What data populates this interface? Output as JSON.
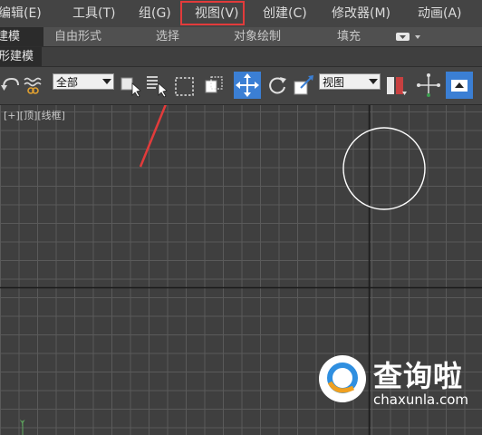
{
  "menu": [
    {
      "label": "编辑(E)"
    },
    {
      "label": "工具(T)"
    },
    {
      "label": "组(G)"
    },
    {
      "label": "视图(V)"
    },
    {
      "label": "创建(C)"
    },
    {
      "label": "修改器(M)"
    },
    {
      "label": "动画(A)"
    }
  ],
  "ribbon": {
    "active_tab": "建模",
    "tabs": [
      "自由形式",
      "选择",
      "对象绘制",
      "填充"
    ]
  },
  "subbar": {
    "active_tab": "形建模"
  },
  "toolbar": {
    "filter_select": "全部",
    "coord_select": "视图"
  },
  "viewport": {
    "label": "[+][顶][线框]"
  },
  "watermark": {
    "brand": "查询啦",
    "domain": "chaxunla.com"
  },
  "colors": {
    "highlight": "#e23b3b",
    "active_tool": "#3b7fd4",
    "menu_bg": "#444444",
    "viewport_bg": "#3f3f3f",
    "grid": "#5a5a5a"
  }
}
